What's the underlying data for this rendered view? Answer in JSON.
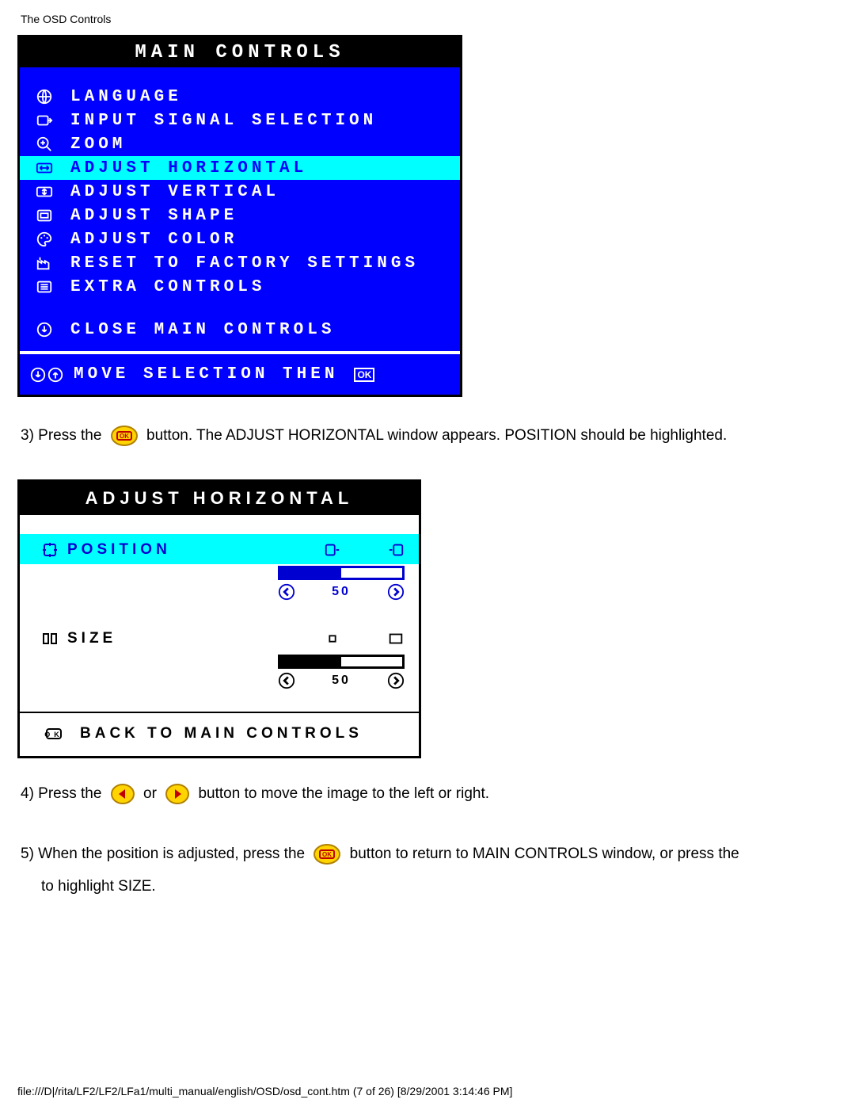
{
  "header": "The OSD Controls",
  "main_menu": {
    "title": "MAIN CONTROLS",
    "items": [
      {
        "icon": "globe",
        "label": "LANGUAGE",
        "selected": false
      },
      {
        "icon": "input",
        "label": "INPUT SIGNAL SELECTION",
        "selected": false
      },
      {
        "icon": "zoom",
        "label": "ZOOM",
        "selected": false
      },
      {
        "icon": "h-arrows",
        "label": "ADJUST HORIZONTAL",
        "selected": true
      },
      {
        "icon": "v-arrows",
        "label": "ADJUST VERTICAL",
        "selected": false
      },
      {
        "icon": "shape",
        "label": "ADJUST SHAPE",
        "selected": false
      },
      {
        "icon": "palette",
        "label": "ADJUST COLOR",
        "selected": false
      },
      {
        "icon": "factory",
        "label": "RESET TO FACTORY SETTINGS",
        "selected": false
      },
      {
        "icon": "list",
        "label": "EXTRA CONTROLS",
        "selected": false
      }
    ],
    "close": {
      "icon": "down-circle",
      "label": "CLOSE MAIN CONTROLS"
    },
    "footer_hint": "MOVE SELECTION THEN",
    "footer_ok": "OK"
  },
  "step3": {
    "prefix": "3) Press the ",
    "suffix": " button. The ADJUST HORIZONTAL window appears. POSITION should be highlighted."
  },
  "sub_menu": {
    "title": "Adjust Horizontal",
    "position": {
      "label": "POSITION",
      "value": "50"
    },
    "size": {
      "label": "SIZE",
      "value": "50"
    },
    "back": "BACK TO MAIN CONTROLS"
  },
  "step4": {
    "prefix": "4) Press the ",
    "mid": " or ",
    "suffix": " button to move the image to the left or right."
  },
  "step5": {
    "prefix": "5) When the position is adjusted, press the ",
    "suffix": " button to return to MAIN CONTROLS window, or press the ",
    "line2": "to highlight SIZE."
  },
  "footer_path": "file:///D|/rita/LF2/LF2/LFa1/multi_manual/english/OSD/osd_cont.htm (7 of 26) [8/29/2001 3:14:46 PM]"
}
